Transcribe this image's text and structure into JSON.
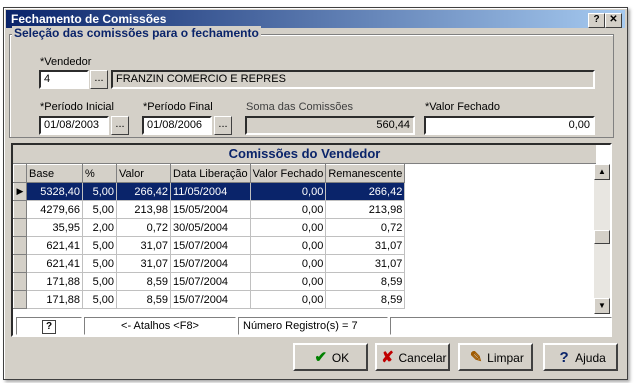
{
  "window": {
    "title": "Fechamento de Comissões",
    "help_btn": "?",
    "close_btn": "✕"
  },
  "group": {
    "title": "Seleção das comissões para o fechamento",
    "vendedor_label": "*Vendedor",
    "vendedor_code": "4",
    "vendedor_name": "FRANZIN COMERCIO E REPRES",
    "periodo_inicial_label": "*Período Inicial",
    "periodo_inicial": "01/08/2003",
    "periodo_final_label": "*Período Final",
    "periodo_final": "01/08/2006",
    "soma_label": "Soma das Comissões",
    "soma_value": "560,44",
    "valor_fechado_label": "*Valor Fechado",
    "valor_fechado_value": "0,00",
    "ellipsis": "..."
  },
  "grid": {
    "caption": "Comissões do Vendedor",
    "columns": [
      "Base",
      "%",
      "Valor",
      "Data Liberação",
      "Valor Fechado",
      "Remanescente"
    ],
    "rows": [
      [
        "5328,40",
        "5,00",
        "266,42",
        "11/05/2004",
        "0,00",
        "266,42"
      ],
      [
        "4279,66",
        "5,00",
        "213,98",
        "15/05/2004",
        "0,00",
        "213,98"
      ],
      [
        "35,95",
        "2,00",
        "0,72",
        "30/05/2004",
        "0,00",
        "0,72"
      ],
      [
        "621,41",
        "5,00",
        "31,07",
        "15/07/2004",
        "0,00",
        "31,07"
      ],
      [
        "621,41",
        "5,00",
        "31,07",
        "15/07/2004",
        "0,00",
        "31,07"
      ],
      [
        "171,88",
        "5,00",
        "8,59",
        "15/07/2004",
        "0,00",
        "8,59"
      ],
      [
        "171,88",
        "5,00",
        "8,59",
        "15/07/2004",
        "0,00",
        "8,59"
      ]
    ],
    "selected_row": 0
  },
  "status": {
    "atalhos": "<- Atalhos <F8>",
    "registros": "Número Registro(s) = 7"
  },
  "buttons": {
    "ok": "OK",
    "cancelar": "Cancelar",
    "limpar": "Limpar",
    "ajuda": "Ajuda"
  }
}
